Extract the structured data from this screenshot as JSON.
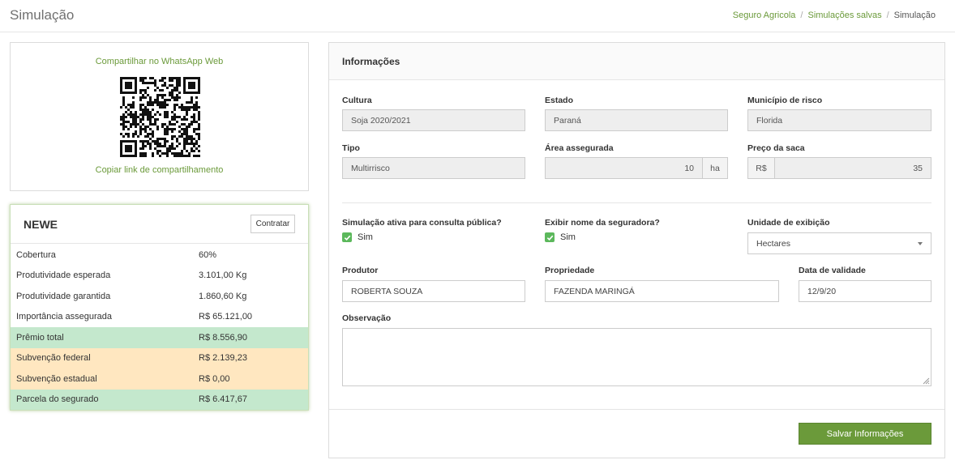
{
  "page": {
    "title": "Simulação",
    "breadcrumb": [
      "Seguro Agricola",
      "Simulações salvas",
      "Simulação"
    ]
  },
  "share": {
    "whatsapp_label": "Compartilhar no WhatsApp Web",
    "copy_label": "Copiar link de compartilhamento"
  },
  "quote": {
    "insurer": "NEWE",
    "contract_label": "Contratar",
    "rows": [
      {
        "label": "Cobertura",
        "value": "60%",
        "highlight": "none"
      },
      {
        "label": "Produtividade esperada",
        "value": "3.101,00 Kg",
        "highlight": "none"
      },
      {
        "label": "Produtividade garantida",
        "value": "1.860,60 Kg",
        "highlight": "none"
      },
      {
        "label": "Importância assegurada",
        "value": "R$ 65.121,00",
        "highlight": "none"
      },
      {
        "label": "Prêmio total",
        "value": "R$ 8.556,90",
        "highlight": "green"
      },
      {
        "label": "Subvenção federal",
        "value": "R$ 2.139,23",
        "highlight": "orange"
      },
      {
        "label": "Subvenção estadual",
        "value": "R$ 0,00",
        "highlight": "orange"
      },
      {
        "label": "Parcela do segurado",
        "value": "R$ 6.417,67",
        "highlight": "green"
      }
    ]
  },
  "info": {
    "title": "Informações",
    "cultura": {
      "label": "Cultura",
      "value": "Soja 2020/2021"
    },
    "estado": {
      "label": "Estado",
      "value": "Paraná"
    },
    "municipio": {
      "label": "Município de risco",
      "value": "Florida"
    },
    "tipo": {
      "label": "Tipo",
      "value": "Multirrisco"
    },
    "area": {
      "label": "Área assegurada",
      "value": "10",
      "unit": "ha"
    },
    "preco": {
      "label": "Preço da saca",
      "prefix": "R$",
      "value": "35"
    },
    "simulacao_publica": {
      "label": "Simulação ativa para consulta pública?",
      "option": "Sim",
      "checked": true
    },
    "exibir_seguradora": {
      "label": "Exibir nome da seguradora?",
      "option": "Sim",
      "checked": true
    },
    "unidade": {
      "label": "Unidade de exibição",
      "value": "Hectares"
    },
    "produtor": {
      "label": "Produtor",
      "value": "ROBERTA SOUZA"
    },
    "propriedade": {
      "label": "Propriedade",
      "value": "FAZENDA MARINGÁ"
    },
    "validade": {
      "label": "Data de validade",
      "value": "12/9/20"
    },
    "observacao": {
      "label": "Observação",
      "value": ""
    },
    "save_label": "Salvar Informações"
  },
  "colors": {
    "accent": "#6b9a3a",
    "highlight_green": "#c4e8cd",
    "highlight_orange": "#ffe7c0",
    "checkbox": "#5cb85c"
  }
}
